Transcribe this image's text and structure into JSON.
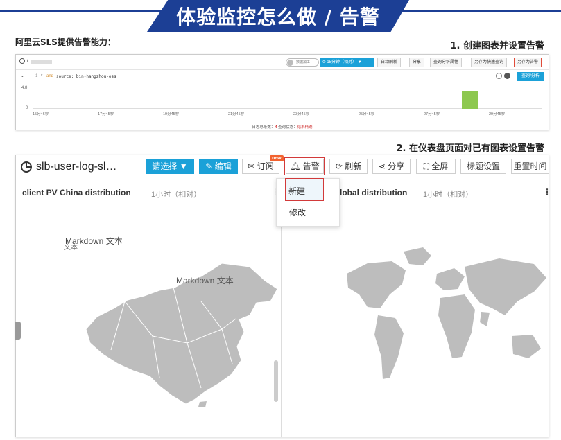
{
  "slide": {
    "title": "体验监控怎么做 / 告警",
    "subtitle_left": "阿里云SLS提供告警能力：",
    "step1": "1. 创建图表并设置告警",
    "step2": "2. 在仪表盘页面对已有图表设置告警"
  },
  "query_panel": {
    "query_prefix": "t",
    "query_line_no": "1",
    "query_star": "*",
    "query_and": "and",
    "query_text": "source: bin-hangzhou-oss",
    "toggle_label": "数据加工",
    "time_label": "15分钟（相对）",
    "buttons": [
      "自动刷新",
      "分享",
      "查询分析属性",
      "另存为快速查询",
      "另存为告警"
    ],
    "analyze_button": "查询/分析",
    "y_ticks": [
      "4.8",
      "0"
    ],
    "x_ticks": [
      "15分46秒",
      "17分45秒",
      "19分45秒",
      "21分45秒",
      "23分45秒",
      "25分45秒",
      "27分45秒",
      "29分45秒"
    ],
    "histogram": {
      "bins": 16,
      "values": [
        0,
        0,
        0,
        0,
        0,
        0,
        0,
        0,
        0,
        0,
        0,
        0,
        0,
        4,
        0,
        0
      ]
    },
    "footer_prefix": "日志总条数：",
    "footer_count": "4",
    "footer_status_label": "查询状态：",
    "footer_status": "结果精确"
  },
  "dashboard": {
    "title": "slb-user-log-sl…",
    "toolbar": {
      "select": "请选择 ▼",
      "edit": "编辑",
      "subscribe": "订阅",
      "new_badge": "new",
      "alarm": "告警",
      "refresh": "刷新",
      "share": "分享",
      "fullscreen": "全屏",
      "title_settings": "标题设置",
      "reset_time": "重置时间"
    },
    "alarm_menu": [
      "新建",
      "修改"
    ],
    "widget_left": {
      "title": "client PV China distribution",
      "time": "1小时（相对）",
      "markdown_label": "Markdown 文本",
      "markdown_overlap": "文本",
      "markdown_label_2": "Markdown 文本"
    },
    "widget_right": {
      "title": "lobal distribution",
      "time": "1小时（相对）"
    }
  },
  "colors": {
    "banner": "#1c3f95",
    "accent": "#1ba1d8",
    "highlight": "#d23a3a",
    "histogram": "#8dc84f",
    "map": "#bdbdbd"
  }
}
